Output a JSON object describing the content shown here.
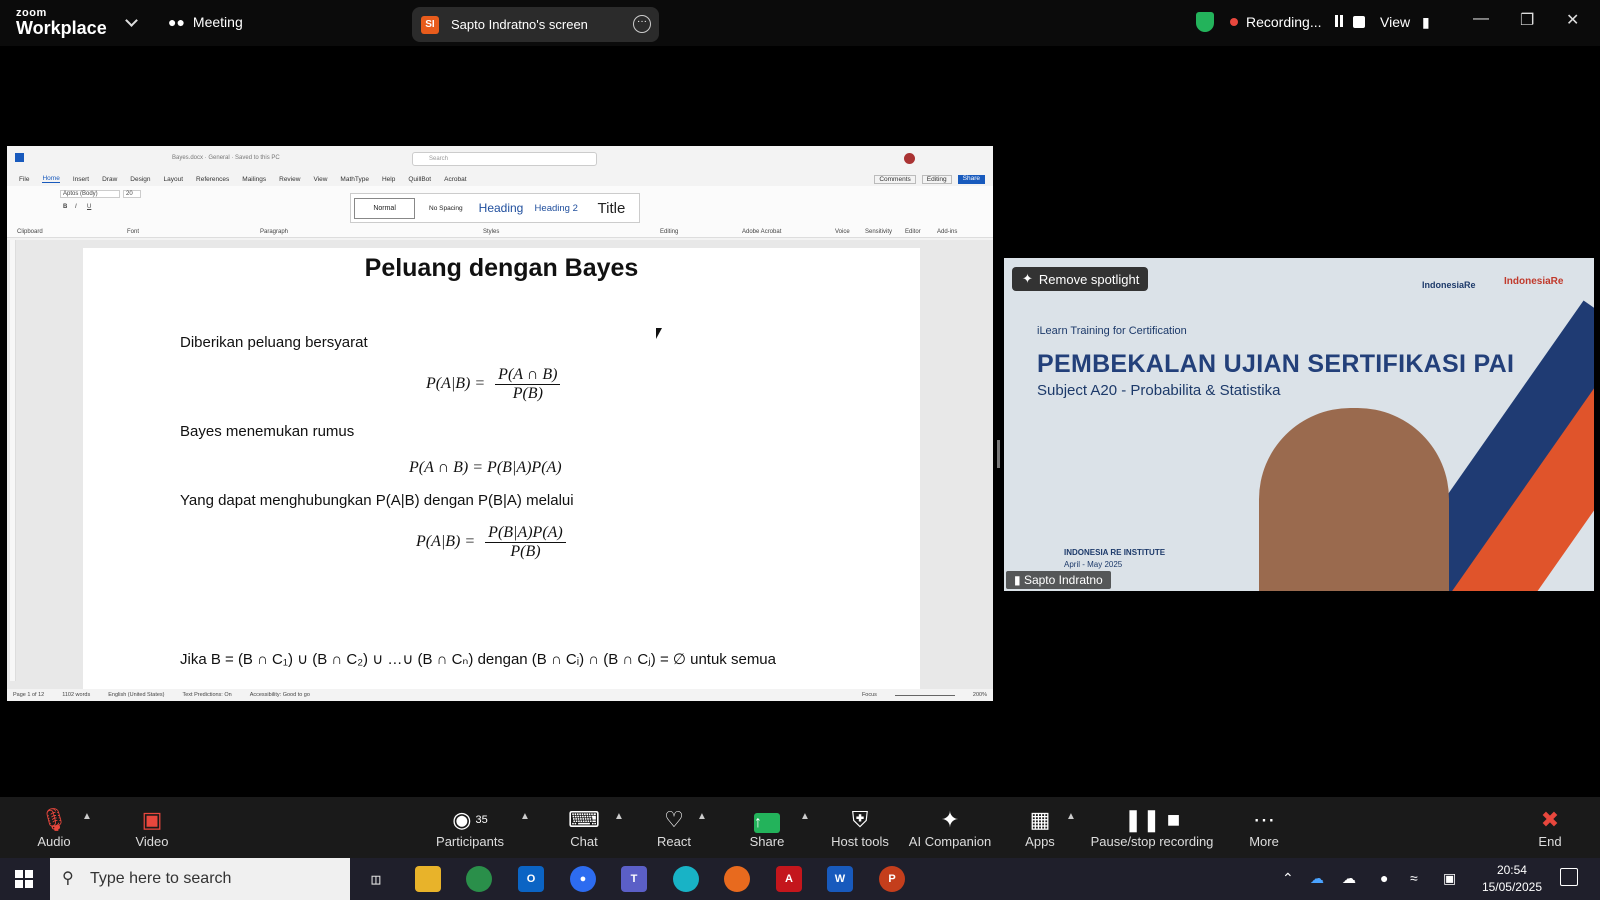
{
  "topbar": {
    "logo_top": "zoom",
    "logo_bottom": "Workplace",
    "meeting_label": "Meeting",
    "screen_badge": "SI",
    "screen_label": "Sapto Indratno's screen",
    "recording_label": "Recording...",
    "view_label": "View"
  },
  "word": {
    "window_title": "Bayes.docx · General · Saved to this PC",
    "search_placeholder": "Search",
    "menu": [
      "File",
      "Home",
      "Insert",
      "Draw",
      "Design",
      "Layout",
      "References",
      "Mailings",
      "Review",
      "View",
      "MathType",
      "Help",
      "QuillBot",
      "Acrobat"
    ],
    "styles": [
      "Normal",
      "No Spacing",
      "Heading",
      "Heading 2",
      "Title"
    ],
    "ribbon_groups": [
      "Clipboard",
      "Font",
      "Paragraph",
      "Styles",
      "Editing",
      "Adobe Acrobat",
      "Voice",
      "Sensitivity",
      "Editor",
      "Add-ins"
    ],
    "font_name": "Aptos (Body)",
    "font_size": "20",
    "comments": "Comments",
    "editing": "Editing",
    "share": "Share",
    "status": [
      "Page 1 of 12",
      "1102 words",
      "English (United States)",
      "Text Predictions: On",
      "Accessibility: Good to go",
      "Focus",
      "200%"
    ]
  },
  "doc": {
    "title": "Peluang dengan Bayes",
    "p1": "Diberikan peluang bersyarat",
    "eq1_lhs": "P(A|B) =",
    "eq1_num": "P(A ∩ B)",
    "eq1_den": "P(B)",
    "p2": "Bayes menemukan rumus",
    "eq2": "P(A ∩ B) = P(B|A)P(A)",
    "p3": "Yang dapat menghubungkan P(A|B) dengan P(B|A) melalui",
    "eq3_lhs": "P(A|B) =",
    "eq3_num": "P(B|A)P(A)",
    "eq3_den": "P(B)",
    "p4": "Jika B = (B ∩ C₁) ∪ (B ∩ C₂) ∪ …∪ (B ∩ Cₙ) dengan (B ∩ Cᵢ) ∩ (B ∩ Cⱼ) = ∅ untuk semua"
  },
  "video": {
    "remove_spotlight": "Remove spotlight",
    "brand1": "IndonesiaRe",
    "brand2": "IndonesiaRe",
    "subtitle": "iLearn Training for Certification",
    "headline": "PEMBEKALAN UJIAN SERTIFIKASI PAI",
    "subject": "Subject A20 - Probabilita & Statistika",
    "institute": "INDONESIA RE INSTITUTE",
    "period": "April - May 2025",
    "participant_name": "Sapto Indratno"
  },
  "toolbar": {
    "audio": "Audio",
    "video": "Video",
    "participants": "Participants",
    "participants_count": "35",
    "chat": "Chat",
    "react": "React",
    "share": "Share",
    "host_tools": "Host tools",
    "ai_companion": "AI Companion",
    "apps": "Apps",
    "pause_stop": "Pause/stop recording",
    "more": "More",
    "end": "End"
  },
  "taskbar": {
    "search_placeholder": "Type here to search",
    "time": "20:54",
    "date": "15/05/2025"
  },
  "colors": {
    "accent_green": "#23b35b",
    "record_red": "#e8473d",
    "word_blue": "#185abd",
    "end_red": "#e8473d"
  }
}
